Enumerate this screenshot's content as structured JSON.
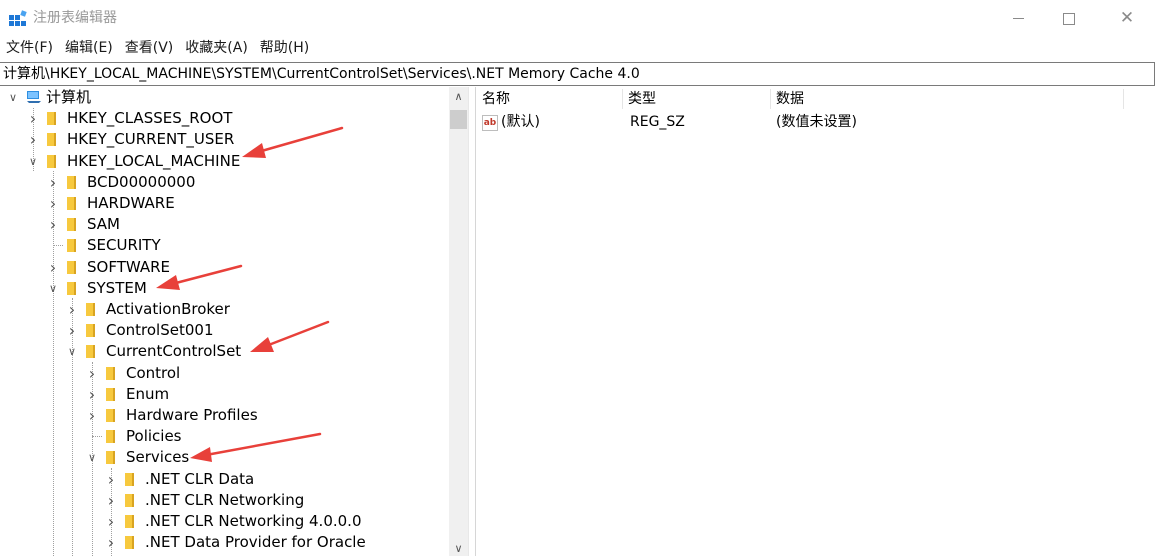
{
  "window": {
    "title": "注册表编辑器",
    "controls": {
      "minimize": "minimize-icon",
      "maximize": "maximize-icon",
      "close": "close-icon"
    }
  },
  "menu": [
    "文件(F)",
    "编辑(E)",
    "查看(V)",
    "收藏夹(A)",
    "帮助(H)"
  ],
  "address": "计算机\\HKEY_LOCAL_MACHINE\\SYSTEM\\CurrentControlSet\\Services\\.NET Memory Cache 4.0",
  "tree": {
    "root": "计算机",
    "nodes": [
      {
        "label": "HKEY_CLASSES_ROOT",
        "state": "collapsed"
      },
      {
        "label": "HKEY_CURRENT_USER",
        "state": "collapsed"
      },
      {
        "label": "HKEY_LOCAL_MACHINE",
        "state": "expanded"
      },
      {
        "label": "BCD00000000",
        "state": "collapsed"
      },
      {
        "label": "HARDWARE",
        "state": "collapsed"
      },
      {
        "label": "SAM",
        "state": "collapsed"
      },
      {
        "label": "SECURITY",
        "state": "leaf"
      },
      {
        "label": "SOFTWARE",
        "state": "collapsed"
      },
      {
        "label": "SYSTEM",
        "state": "expanded"
      },
      {
        "label": "ActivationBroker",
        "state": "collapsed"
      },
      {
        "label": "ControlSet001",
        "state": "collapsed"
      },
      {
        "label": "CurrentControlSet",
        "state": "expanded"
      },
      {
        "label": "Control",
        "state": "collapsed"
      },
      {
        "label": "Enum",
        "state": "collapsed"
      },
      {
        "label": "Hardware Profiles",
        "state": "collapsed"
      },
      {
        "label": "Policies",
        "state": "leaf"
      },
      {
        "label": "Services",
        "state": "expanded"
      },
      {
        "label": ".NET CLR Data",
        "state": "collapsed"
      },
      {
        "label": ".NET CLR Networking",
        "state": "collapsed"
      },
      {
        "label": ".NET CLR Networking 4.0.0.0",
        "state": "collapsed"
      },
      {
        "label": ".NET Data Provider for Oracle",
        "state": "collapsed"
      }
    ]
  },
  "values": {
    "columns": [
      "名称",
      "类型",
      "数据"
    ],
    "rows": [
      {
        "name": "(默认)",
        "type": "REG_SZ",
        "data": "(数值未设置)",
        "icon": "string-value-icon"
      }
    ]
  },
  "colors": {
    "folder": "#f7c93e",
    "annotation_arrow": "#e8403a",
    "scrollbar_thumb": "#cdcdcd"
  }
}
